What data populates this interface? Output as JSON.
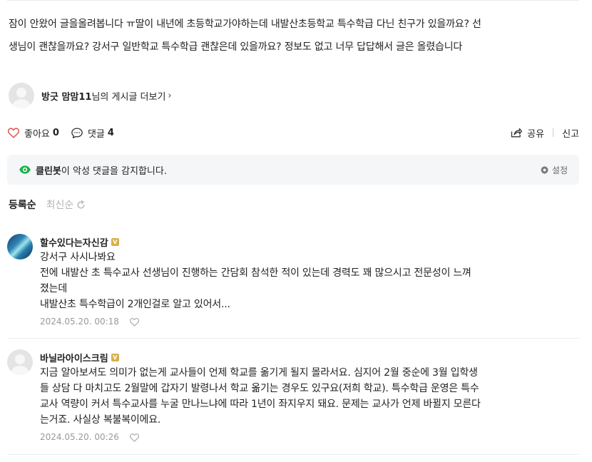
{
  "post": {
    "line1": "잠이 안왔어 글을올려봅니다 ㅠ딸이 내년에 초등학교가야하는데  내발산초등학교 특수학급 다닌 친구가 있을까요? 선",
    "line2": "생님이  괜찮을까요? 강서구 일반학교 특수학급 괜찮은데 있을까요? 정보도 없고  너무 답답해서 글은 올렸습니다"
  },
  "author": {
    "name": "방긋 맘맘11",
    "suffix": "님의 게시글 더보기",
    "chevron": "›"
  },
  "actions": {
    "like_label": "좋아요",
    "like_count": "0",
    "comment_label": "댓글",
    "comment_count": "4",
    "share_label": "공유",
    "report_label": "신고"
  },
  "cleanbot": {
    "name": "클린봇",
    "message": "이 악성 댓글을 감지합니다.",
    "settings_label": "설정"
  },
  "sort": {
    "active": "등록순",
    "inactive": "최신순"
  },
  "comments": [
    {
      "author": "할수있다는자신감",
      "badge": "V",
      "lines": [
        "강서구 사시나봐요",
        "전에 내발산 초 특수교사 선생님이 진행하는 간담회 참석한 적이 있는데 경력도 꽤 많으시고 전문성이 느껴",
        "졌는데",
        "내발산초 특수학급이 2개인걸로 알고 있어서..."
      ],
      "date": "2024.05.20. 00:18"
    },
    {
      "author": "바닐라아이스크림",
      "badge": "V",
      "lines": [
        "지금 알아보셔도 의미가 없는게 교사들이 언제 학교를 옮기게 될지 몰라서요. 심지어 2월 중순에 3월 입학생",
        "들 상담 다 마치고도 2월말에 갑자기 발령나서 학교 옮기는 경우도 있구요(저희 학교). 특수학급 운영은 특수",
        "교사 역량이 커서 특수교사를 누굴 만나느냐에 따라 1년이 좌지우지 돼요. 문제는 교사가 언제 바뀔지 모른다",
        "는거죠. 사실상 복불복이에요."
      ],
      "date": "2024.05.20. 00:26"
    }
  ],
  "colors": {
    "like_heart": "#d9534f",
    "cleanbot_green": "#19b24b",
    "badge_gold": "#d6b04a"
  }
}
